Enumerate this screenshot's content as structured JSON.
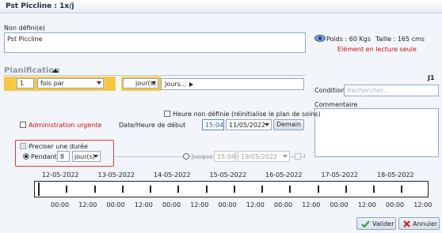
{
  "window": {
    "title": "Pst Piccline : 1x/j"
  },
  "name_section": {
    "label": "Non défini(e)",
    "value": "Pst Piccline"
  },
  "patient_info": {
    "weight": "Poids : 60 Kgs",
    "height": "Taille : 165 cms",
    "readonly_notice": "Elément en lecture seule"
  },
  "planification": {
    "title": "Planification",
    "frequency_count": "1",
    "frequency_unit": "fois par",
    "period_unit": "jour(s)",
    "days_label": "Jours...",
    "day_code": "J1",
    "condition_label": "Condition",
    "condition_placeholder": "Rechercher...",
    "commentaire_label": "Commentaire",
    "heure_non_definie": "Heure non définie (réinitialise le plan de soins)",
    "urgent_label": "Administration urgente",
    "start_label": "Date/Heure de début",
    "start_time": "15:04",
    "start_date": "11/05/2022",
    "demain_button": "Demain",
    "duree_label": "Preciser une durée",
    "pendant_label": "Pendant",
    "pendant_value": "8",
    "pendant_unit": "jour(s)",
    "jusque_label": "Jusque",
    "jusque_time": "15:04",
    "jusque_date": "19/05/2022"
  },
  "timeline": {
    "dates": [
      "12-05-2022",
      "13-05-2022",
      "14-05-2022",
      "15-05-2022",
      "16-05-2022",
      "17-05-2022",
      "18-05-2022"
    ],
    "hours": [
      "00:00",
      "12:00",
      "00:00",
      "12:00",
      "00:00",
      "12:00",
      "00:00",
      "12:00",
      "00:00",
      "12:00",
      "00:00",
      "12:00",
      "00:00",
      "12:00"
    ]
  },
  "buttons": {
    "valider": "Valider",
    "annuler": "Annuler"
  },
  "colors": {
    "required_highlight": "#f6c945",
    "error_text": "#d10f0f",
    "focus_border": "#e0393e",
    "valider_icon": "#3aa63a",
    "annuler_icon": "#d42020"
  }
}
